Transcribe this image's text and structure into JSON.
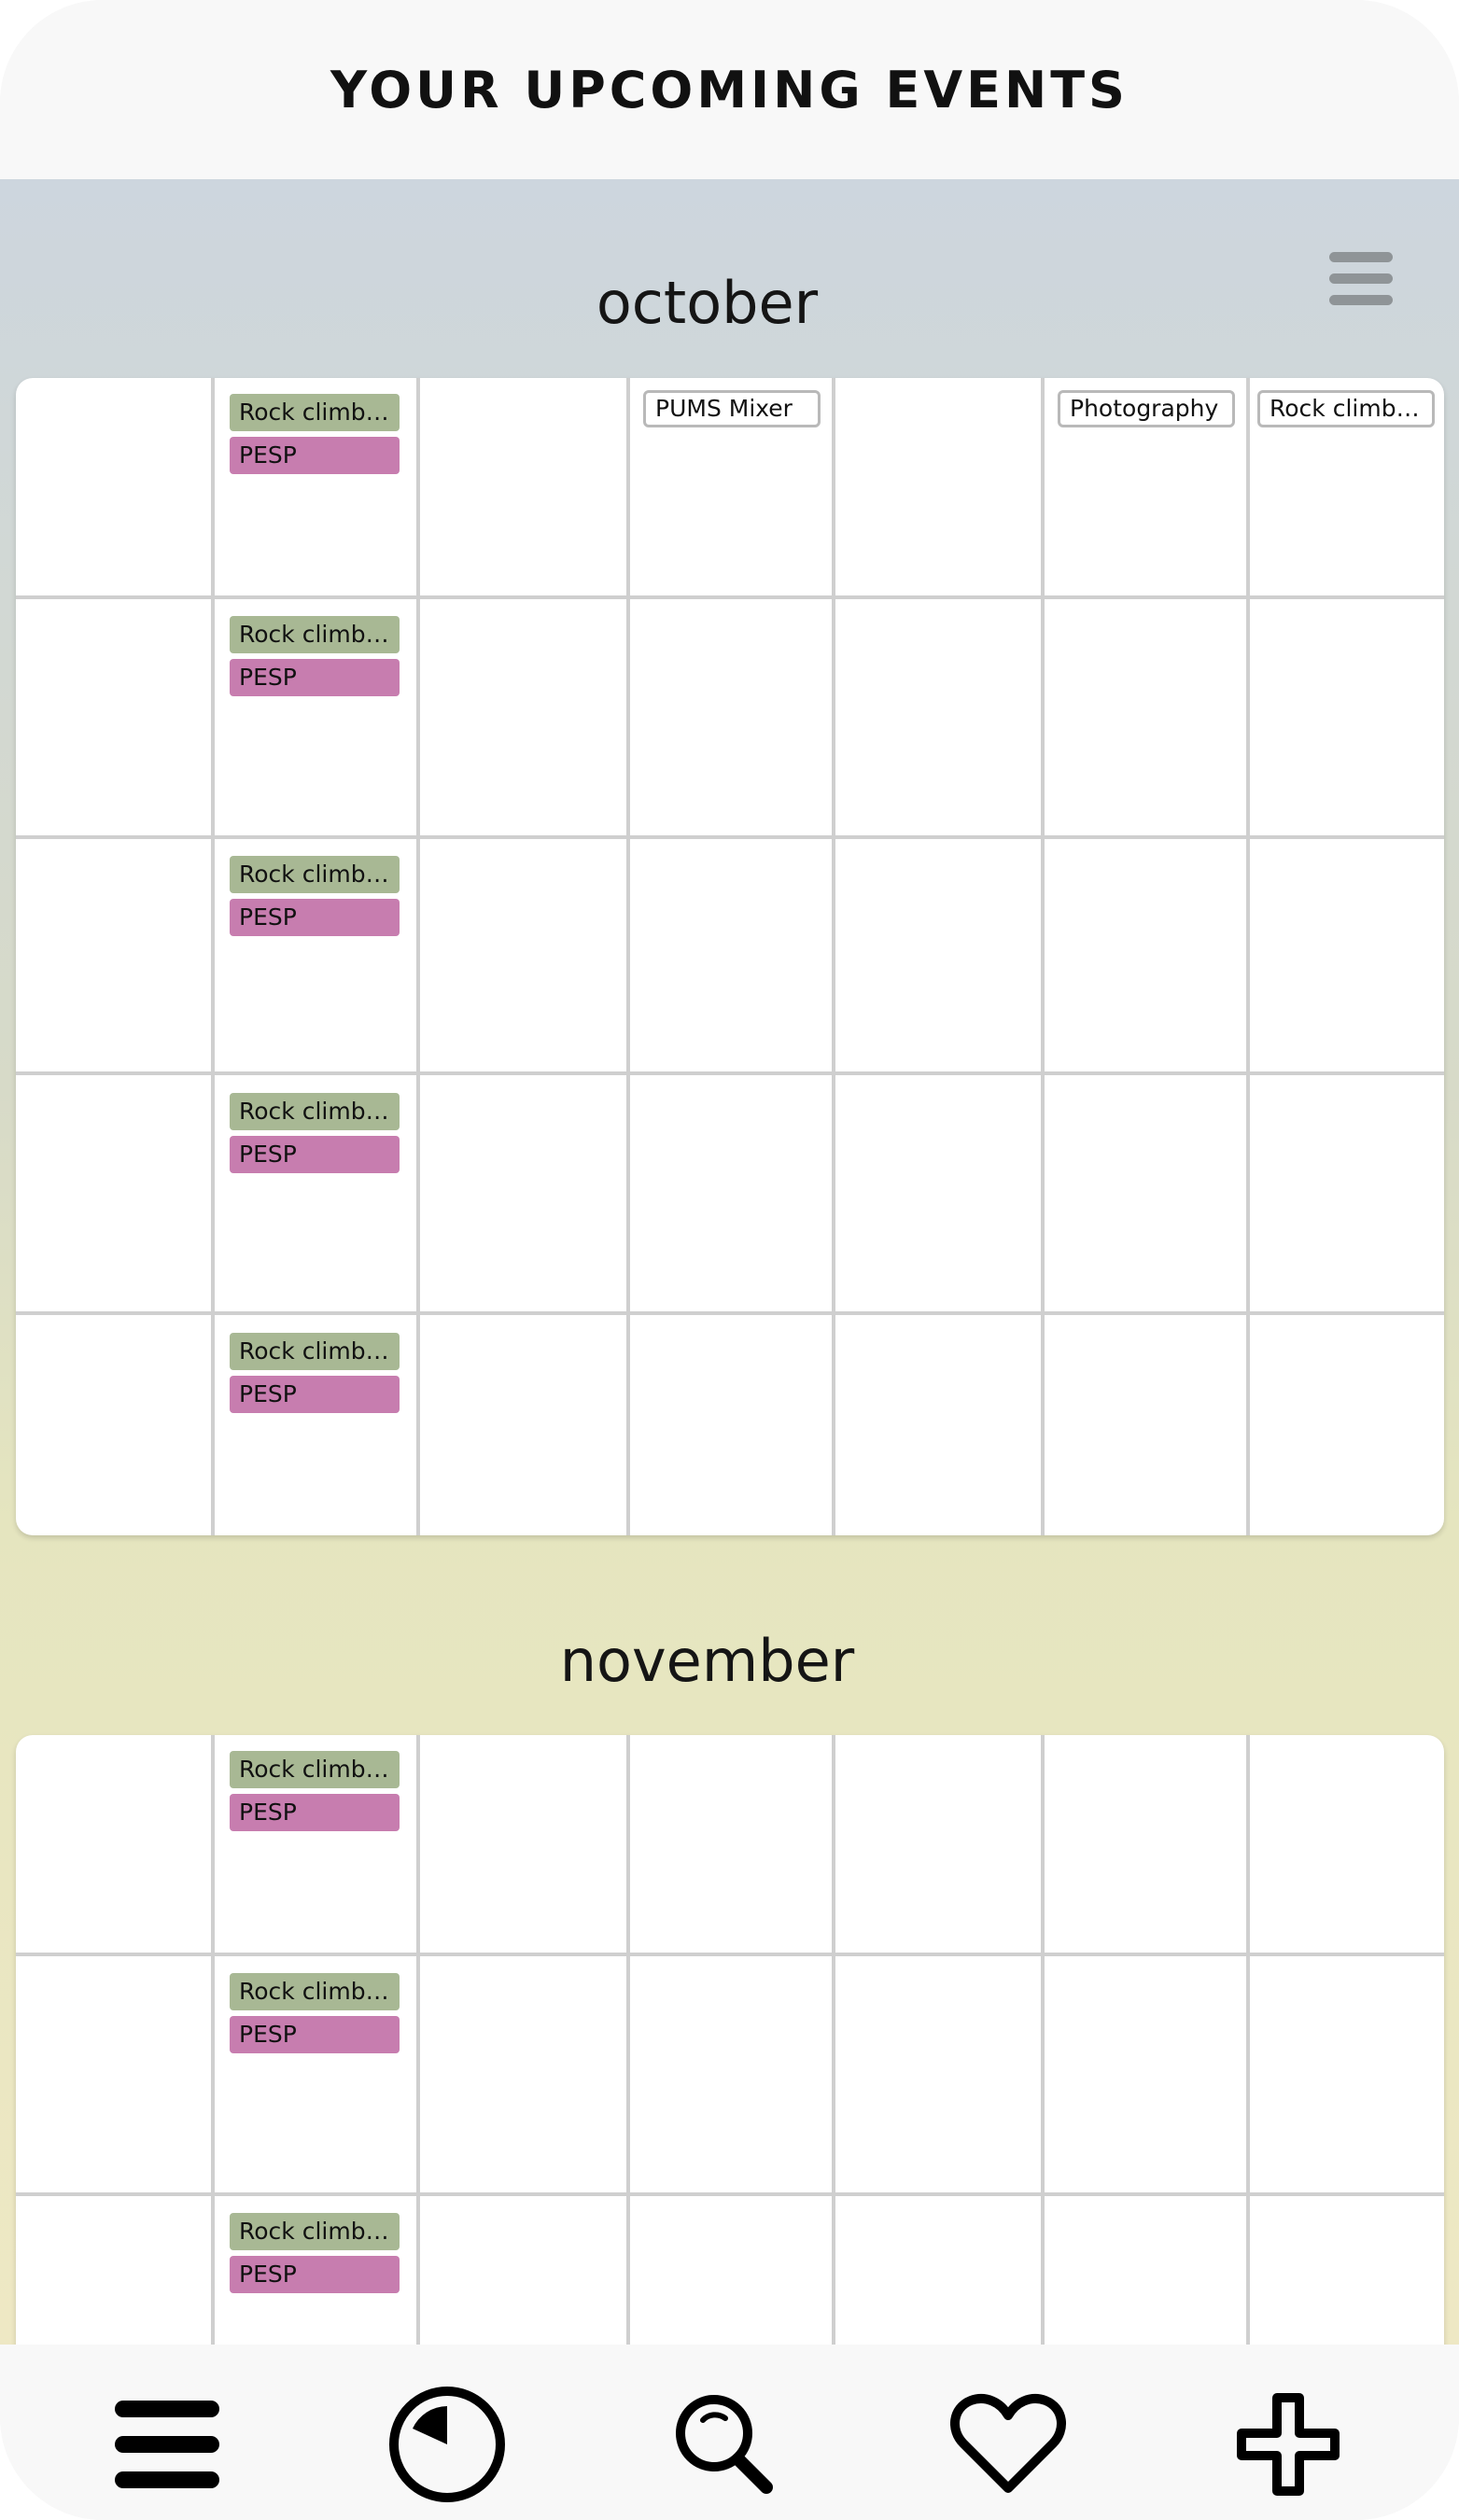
{
  "header": {
    "title": "YOUR UPCOMING EVENTS"
  },
  "months": [
    {
      "name": "october"
    },
    {
      "name": "november"
    }
  ],
  "events": {
    "rock_climbing_weekly": "Rock climbing",
    "pesp": "PESP",
    "pums_mixer": "PUMS Mixer",
    "photography": "Photography",
    "rock_climbing_single": "Rock climbing"
  },
  "colors": {
    "green_chip": "#a8b894",
    "pink_chip": "#c77daf",
    "outline_chip_border": "#b9b9b9"
  },
  "nav": {
    "icons": [
      "menu-icon",
      "clock-icon",
      "search-icon",
      "heart-icon",
      "plus-icon"
    ]
  }
}
